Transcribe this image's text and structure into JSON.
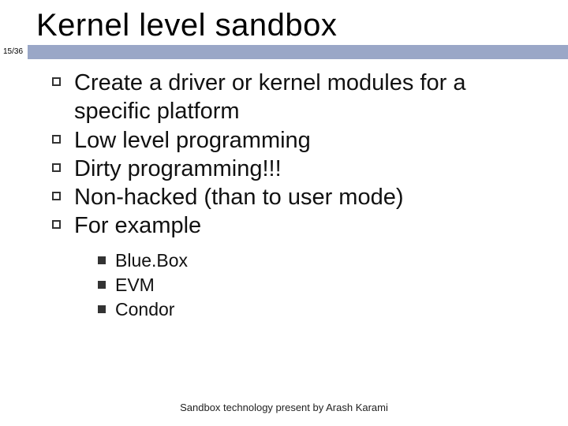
{
  "title": "Kernel level sandbox",
  "page_indicator": "15/36",
  "bullets": [
    "Create a driver or kernel modules for a specific platform",
    "Low level programming",
    "Dirty programming!!!",
    "Non-hacked (than to user mode)",
    "For example"
  ],
  "sub_bullets": [
    "Blue.Box",
    "EVM",
    "Condor"
  ],
  "footer": "Sandbox technology present by Arash Karami"
}
